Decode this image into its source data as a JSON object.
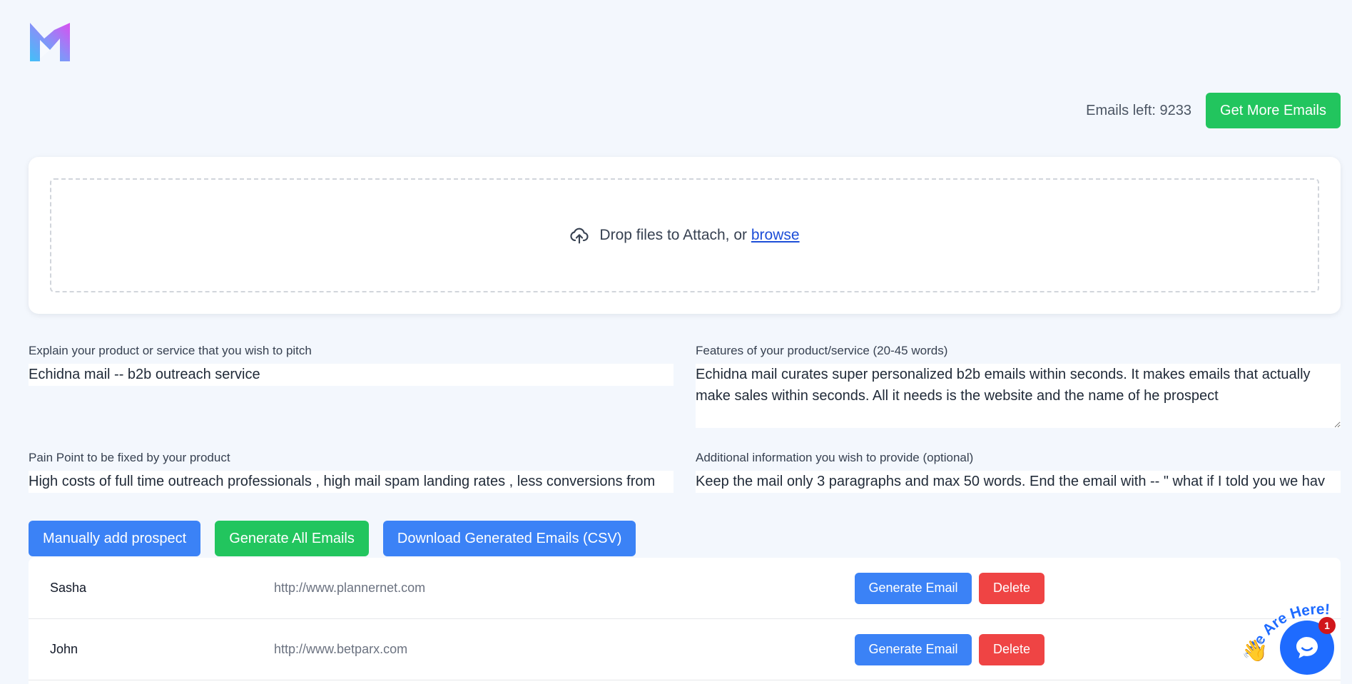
{
  "header": {
    "credits_label": "Emails left: 9233",
    "get_more_label": "Get More Emails"
  },
  "upload": {
    "drop_text": "Drop files to Attach, or",
    "browse_label": "browse"
  },
  "form": {
    "product": {
      "label": "Explain your product or service that you wish to pitch",
      "value": "Echidna mail -- b2b outreach service"
    },
    "features": {
      "label": "Features of your product/service (20-45 words)",
      "value": "Echidna mail curates super personalized b2b emails within seconds. It makes emails that actually make sales within seconds. All it needs is the website and the name of he prospect"
    },
    "pain_point": {
      "label": "Pain Point to be fixed by your product",
      "value": "High costs of full time outreach professionals , high mail spam landing rates , less conversions from"
    },
    "additional": {
      "label": "Additional information you wish to provide (optional)",
      "value": "Keep the mail only 3 paragraphs and max 50 words. End the email with -- \" what if I told you we hav"
    }
  },
  "actions": {
    "add_prospect_label": "Manually add prospect",
    "generate_all_label": "Generate All Emails",
    "download_label": "Download Generated Emails (CSV)"
  },
  "prospects": [
    {
      "name": "Sasha",
      "url": "http://www.plannernet.com",
      "generate_label": "Generate Email",
      "delete_label": "Delete"
    },
    {
      "name": "John",
      "url": "http://www.betparx.com",
      "generate_label": "Generate Email",
      "delete_label": "Delete"
    }
  ],
  "chat": {
    "banner_text": "We Are Here!",
    "badge_count": "1"
  },
  "colors": {
    "background": "#f3f7fd",
    "primary_blue": "#3b82f6",
    "success_green": "#22c55e",
    "danger_red": "#ef4444",
    "link_blue": "#1d4ed8",
    "chat_blue": "#1e6bff"
  },
  "icons": {
    "logo": "brand-m-logo",
    "upload": "cloud-upload-icon",
    "chat": "chat-bubble-icon",
    "wave": "waving-hand-icon"
  }
}
